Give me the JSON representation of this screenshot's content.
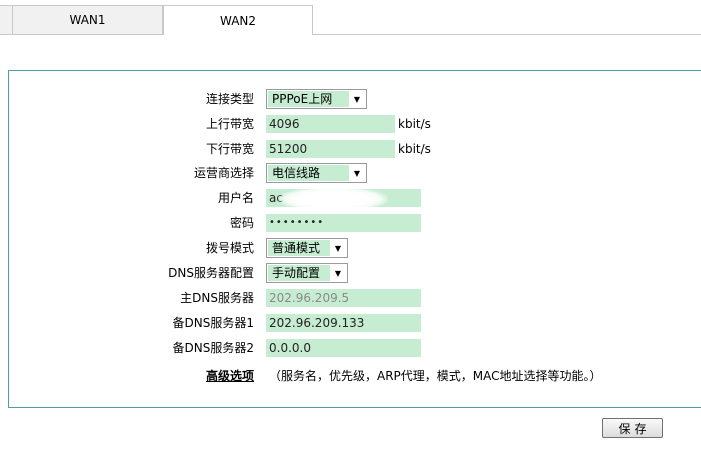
{
  "tabs": [
    {
      "label": "WAN1"
    },
    {
      "label": "WAN2"
    }
  ],
  "form": {
    "connection_type": {
      "label": "连接类型",
      "value": "PPPoE上网"
    },
    "upstream": {
      "label": "上行带宽",
      "value": "4096",
      "unit": "kbit/s"
    },
    "downstream": {
      "label": "下行带宽",
      "value": "51200",
      "unit": "kbit/s"
    },
    "isp": {
      "label": "运营商选择",
      "value": "电信线路"
    },
    "username": {
      "label": "用户名",
      "value": "ac"
    },
    "password": {
      "label": "密码",
      "value": "••••••••"
    },
    "dial_mode": {
      "label": "拨号模式",
      "value": "普通模式"
    },
    "dns_config": {
      "label": "DNS服务器配置",
      "value": "手动配置"
    },
    "dns_primary": {
      "label": "主DNS服务器",
      "value": "202.96.209.5"
    },
    "dns_backup1": {
      "label": "备DNS服务器1",
      "value": "202.96.209.133"
    },
    "dns_backup2": {
      "label": "备DNS服务器2",
      "value": "0.0.0.0"
    },
    "advanced": {
      "label": "高级选项",
      "desc": "（服务名，优先级，ARP代理，模式，MAC地址选择等功能。）"
    }
  },
  "save_label": "保存",
  "colors": {
    "field_bg": "#c6ecd2",
    "panel_border": "#4f9ea5"
  }
}
